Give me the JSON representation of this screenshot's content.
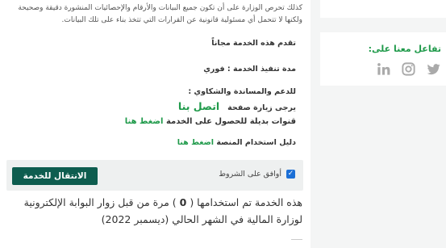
{
  "main": {
    "paragraph": "كذلك تحرص الوزارة على أن تكون جميع البيانات والأرقام والإحصائيات المنشورة دقيقة وصحيحة ولكنها لا تتحمل أي مسئولية قانونية عن القرارات التي تتخذ بناء على تلك البيانات.",
    "free_service": "تقدم هذه الخدمة مجاناً",
    "duration": "مدة تنفيذ الخدمة : فوري",
    "support_heading": "للدعم والمساندة والشكاوي :",
    "visit_prefix": "يرجى زيارة صفحة",
    "contact_link": "اتصل بنا",
    "alt_channels": "قنوات بديلة للحصول على الخدمة",
    "press_here": "اضغط هنا",
    "platform_guide": "دليل استخدام المنصة",
    "press_here_2": "اضغط هنا",
    "agree_label": "أوافق على الشروط",
    "transfer_button": "الانتقال للخدمة",
    "usage_prefix": "هذه الخدمة تم استخدامها (",
    "usage_count": "0",
    "usage_suffix": ") مرة من قبل زوار البوابة الإلكترونية لوزارة المالية في الشهر الحالي (ديسمبر 2022)"
  },
  "sidebar": {
    "interact_title": "تفاعل معنا على:",
    "social_icons": [
      "linkedin-icon",
      "instagram-icon",
      "twitter-icon"
    ]
  },
  "colors": {
    "accent_green": "#1f9a4a",
    "button_bg": "#0e5d4f",
    "checkbox_blue": "#1b6fd6"
  }
}
